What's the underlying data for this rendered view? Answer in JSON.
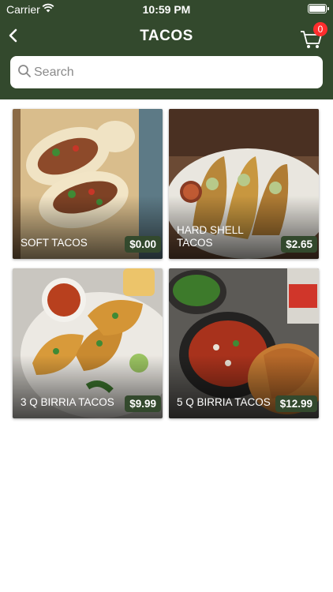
{
  "status_bar": {
    "carrier": "Carrier",
    "time": "10:59 PM"
  },
  "header": {
    "title": "TACOS",
    "cart_count": "0"
  },
  "search": {
    "placeholder": "Search"
  },
  "colors": {
    "header_bg": "#33492d",
    "badge": "#ff2d2d",
    "price_tag": "#33492d"
  },
  "items": [
    {
      "name": "SOFT TACOS",
      "price": "$0.00"
    },
    {
      "name": "HARD SHELL TACOS",
      "price": "$2.65"
    },
    {
      "name": "3 Q BIRRIA TACOS",
      "price": "$9.99"
    },
    {
      "name": "5 Q BIRRIA TACOS",
      "price": "$12.99"
    }
  ]
}
